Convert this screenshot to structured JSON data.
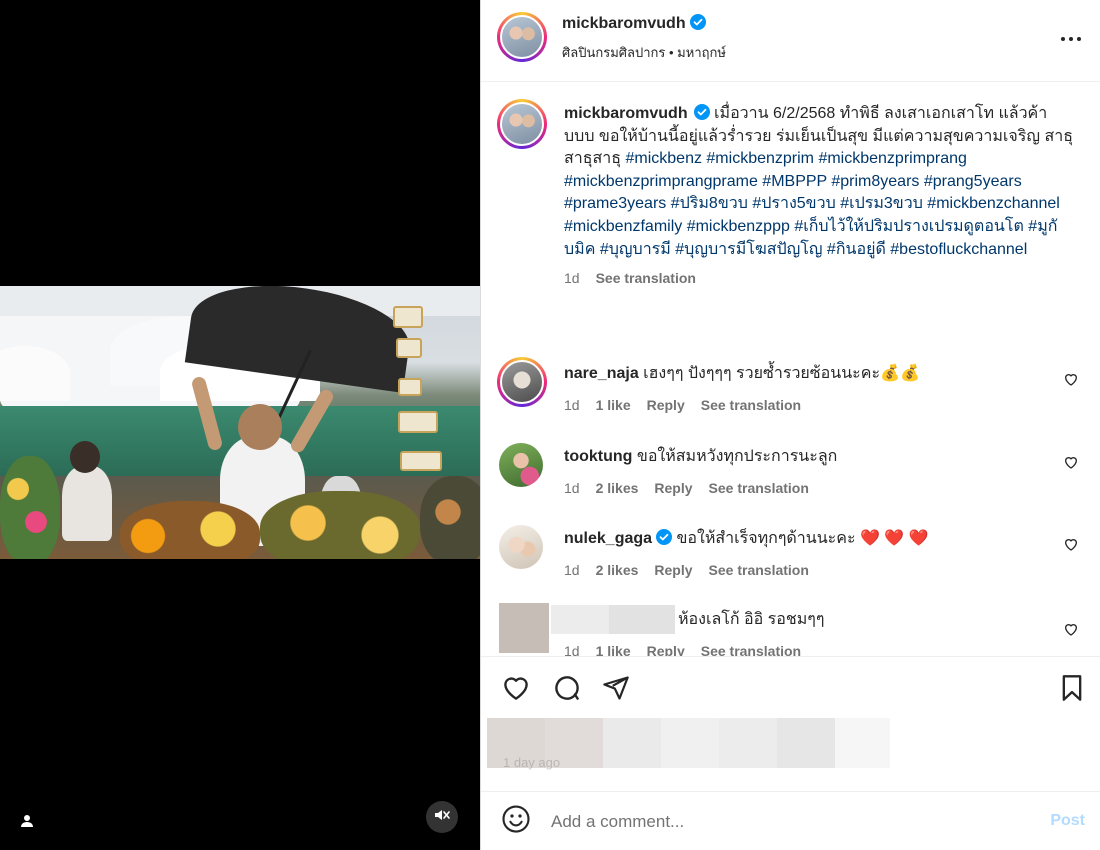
{
  "post": {
    "author": "mickbaromvudh",
    "subtitle": "ศิลปินกรมศิลปากร • มหาฤกษ์",
    "caption": {
      "username": "mickbaromvudh",
      "text": "เมื่อวาน 6/2/2568 ทำพิธี ลงเสาเอกเสาโท แล้วค้าบบบ ขอให้บ้านนี้อยู่แล้วร่ำรวย ร่มเย็นเป็นสุข มีแต่ความสุขความเจริญ สาธุสาธุสาธุ",
      "hashtags": "#mickbenz #mickbenzprim #mickbenzprimprang #mickbenzprimprangprame #MBPPP #prim8years #prang5years #prame3years #ปริม8ขวบ #ปราง5ขวบ #เปรม3ขวบ #mickbenzchannel #mickbenzfamily #mickbenzppp #เก็บไว้ให้ปริมปรางเปรมดูตอนโต #มูกับมิค #บุญบารมี #บุญบารมีโฆสปัญโญ #กินอยู่ดี #bestofluckchannel",
      "time": "1d",
      "see_translation": "See translation"
    }
  },
  "comments": [
    {
      "username": "nare_naja",
      "text": "เฮงๆๆ ปังๆๆๆ รวยซ้ำรวยซ้อนนะคะ💰💰",
      "time": "1d",
      "likes": "1 like",
      "reply": "Reply",
      "see_translation": "See translation",
      "verified": false
    },
    {
      "username": "tooktung",
      "text": "ขอให้สมหวังทุกประการนะลูก",
      "time": "1d",
      "likes": "2 likes",
      "reply": "Reply",
      "see_translation": "See translation",
      "verified": false
    },
    {
      "username": "nulek_gaga",
      "text": "ขอให้สำเร็จทุกๆด้านนะคะ ❤️ ❤️ ❤️",
      "time": "1d",
      "likes": "2 likes",
      "reply": "Reply",
      "see_translation": "See translation",
      "verified": true
    },
    {
      "username": "",
      "text": "ห้องเลโก้ อิอิ รอชมๆๆ",
      "time": "1d",
      "likes": "1 like",
      "reply": "Reply",
      "see_translation": "See translation",
      "verified": false
    }
  ],
  "actions": {
    "like_icon": "heart-icon",
    "comment_icon": "comment-bubble-icon",
    "share_icon": "paper-plane-icon",
    "save_icon": "bookmark-icon"
  },
  "time_ago": "1 day ago",
  "add_comment": {
    "placeholder": "Add a comment...",
    "post_label": "Post"
  },
  "colors": {
    "hashtag": "#00376b",
    "muted": "#737373",
    "verified": "#0095f6",
    "post_disabled": "#b3dbff",
    "heart": "#ed4956"
  }
}
